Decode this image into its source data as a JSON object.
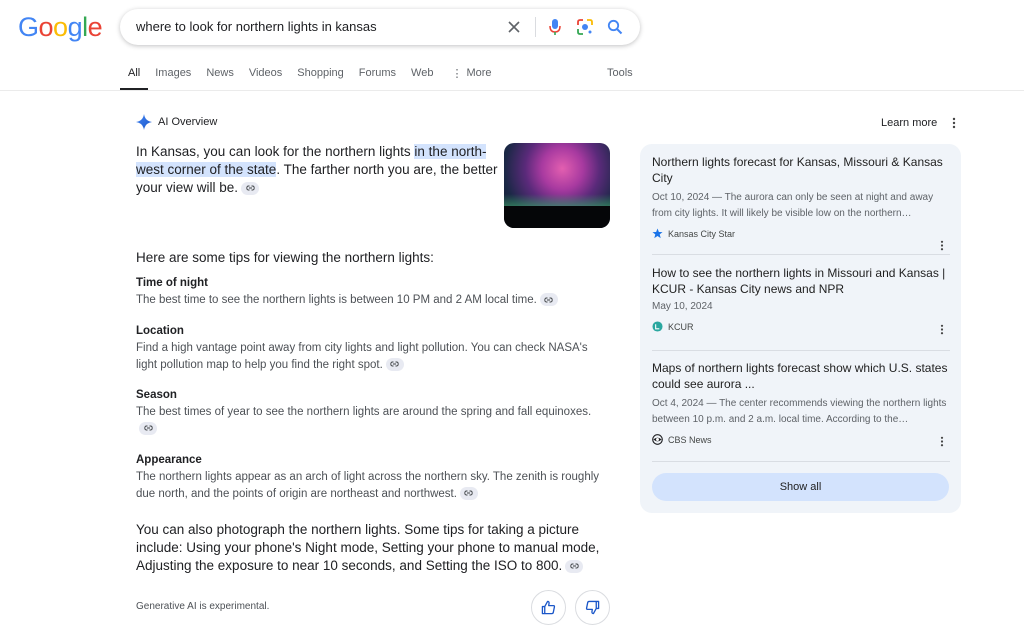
{
  "logo": {
    "text": "Google",
    "letters": [
      {
        "ch": "G",
        "color": "#4285F4"
      },
      {
        "ch": "o",
        "color": "#EA4335"
      },
      {
        "ch": "o",
        "color": "#FBBC05"
      },
      {
        "ch": "g",
        "color": "#4285F4"
      },
      {
        "ch": "l",
        "color": "#34A853"
      },
      {
        "ch": "e",
        "color": "#EA4335"
      }
    ]
  },
  "search": {
    "query": "where to look for northern lights in kansas"
  },
  "icons": {
    "clear": "close-icon",
    "voice": "microphone-icon",
    "lens": "google-lens-icon",
    "search": "search-icon"
  },
  "tabs": [
    "All",
    "Images",
    "News",
    "Videos",
    "Shopping",
    "Forums",
    "Web",
    "More"
  ],
  "tools_label": "Tools",
  "ai_overview": {
    "title": "AI Overview",
    "learn_more": "Learn more",
    "intro_before": "In Kansas, you can look for the northern lights ",
    "intro_highlight": "in the north-west corner of the state",
    "intro_after": ". The farther north you are, the better your view will be.",
    "tips_heading": "Here are some tips for viewing the northern lights:",
    "tips": [
      {
        "heading": "Time of night",
        "text": "The best time to see the northern lights is between 10 PM and 2 AM local time."
      },
      {
        "heading": "Location",
        "text": "Find a high vantage point away from city lights and light pollution. You can check NASA's light pollution map to help you find the right spot."
      },
      {
        "heading": "Season",
        "text": "The best times of year to see the northern lights are around the spring and fall equinoxes."
      },
      {
        "heading": "Appearance",
        "text": "The northern lights appear as an arch of light across the northern sky. The zenith is roughly due north, and the points of origin are northeast and northwest."
      }
    ],
    "photo_text": "You can also photograph the northern lights. Some tips for taking a picture include: Using your phone's Night mode, Setting your phone to manual mode, Adjusting the exposure to near 10 seconds, and Setting the ISO to 800.",
    "disclaimer": "Generative AI is experimental."
  },
  "sources": [
    {
      "title": "Northern lights forecast for Kansas, Missouri & Kansas City",
      "date_snippet": "Oct 10, 2024 — The aurora can only be seen at night and away from city lights. It will likely be visible low on the northern…",
      "site": "Kansas City Star",
      "favicon": "star-icon"
    },
    {
      "title": "How to see the northern lights in Missouri and Kansas | KCUR - Kansas City news and NPR",
      "date_snippet": "May 10, 2024",
      "site": "KCUR",
      "favicon": "kcur-icon"
    },
    {
      "title": "Maps of northern lights forecast show which U.S. states could see aurora ...",
      "date_snippet": "Oct 4, 2024 — The center recommends viewing the northern lights between 10 p.m. and 2 a.m. local time. According to the…",
      "site": "CBS News",
      "favicon": "cbs-eye-icon"
    }
  ],
  "show_all": "Show all",
  "colors": {
    "accent_blue": "#1a73e8",
    "highlight": "#d3e3fd",
    "panel_bg": "#f0f4f9"
  }
}
